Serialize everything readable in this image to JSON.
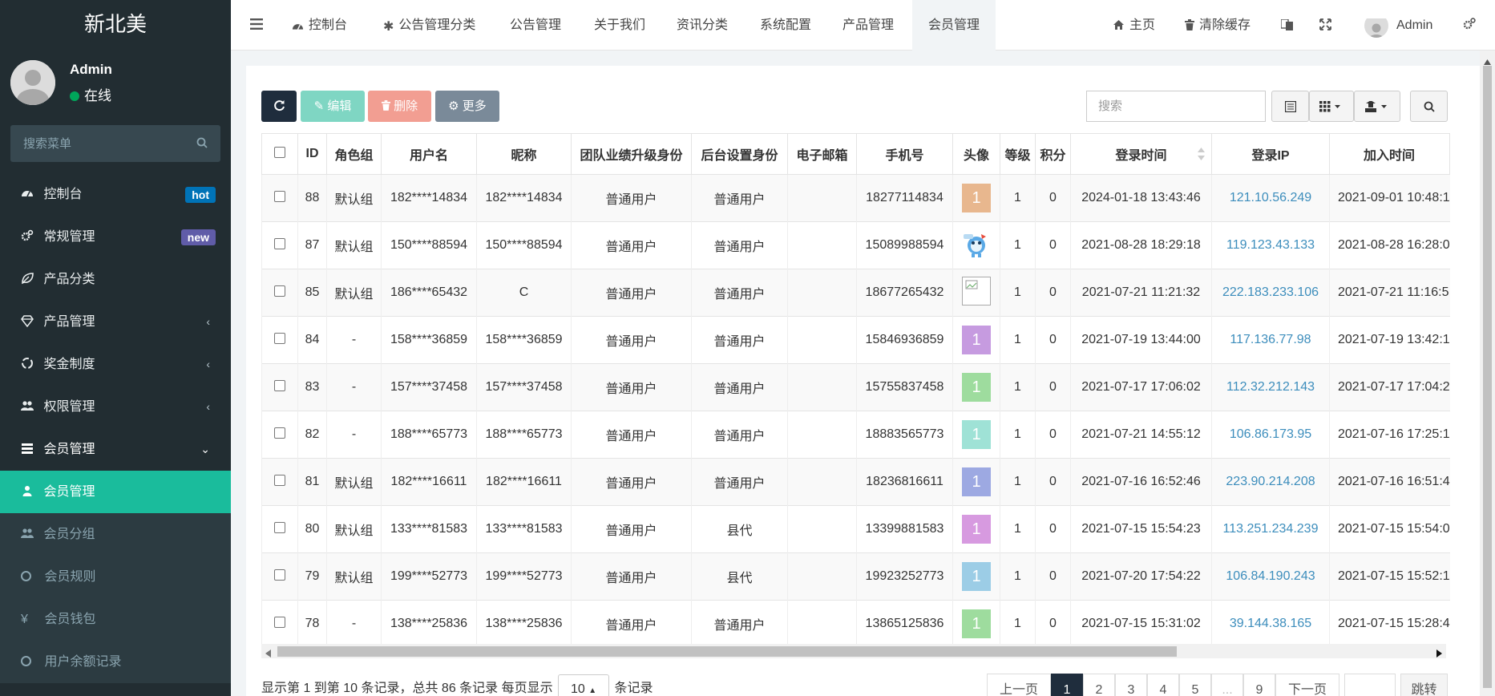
{
  "sidebar": {
    "logo": "新北美",
    "user": {
      "name": "Admin",
      "status": "在线"
    },
    "search_placeholder": "搜索菜单",
    "items": [
      {
        "label": "控制台",
        "badge": "hot",
        "badge_color": "#0073b7"
      },
      {
        "label": "常规管理",
        "badge": "new",
        "badge_color": "#605ca8"
      },
      {
        "label": "产品分类"
      },
      {
        "label": "产品管理"
      },
      {
        "label": "奖金制度"
      },
      {
        "label": "权限管理"
      },
      {
        "label": "会员管理"
      }
    ],
    "subitems": [
      {
        "label": "会员管理"
      },
      {
        "label": "会员分组"
      },
      {
        "label": "会员规则"
      },
      {
        "label": "会员钱包"
      },
      {
        "label": "用户余额记录"
      }
    ],
    "yen_symbol": "¥"
  },
  "topnav": {
    "tabs": [
      "控制台",
      "公告管理分类",
      "公告管理",
      "关于我们",
      "资讯分类",
      "系统配置",
      "产品管理",
      "会员管理"
    ],
    "home": "主页",
    "clear_cache": "清除缓存",
    "admin": "Admin"
  },
  "toolbar": {
    "edit": "编辑",
    "delete": "删除",
    "more": "更多",
    "search_placeholder": "搜索"
  },
  "table": {
    "headers": [
      "ID",
      "角色组",
      "用户名",
      "昵称",
      "团队业绩升级身份",
      "后台设置身份",
      "电子邮箱",
      "手机号",
      "头像",
      "等级",
      "积分",
      "登录时间",
      "登录IP",
      "加入时间"
    ],
    "rows": [
      {
        "id": "88",
        "group": "默认组",
        "username": "182****14834",
        "nickname": "182****14834",
        "team": "普通用户",
        "admin_role": "普通用户",
        "email": "",
        "mobile": "18277114834",
        "avatar": "1",
        "avatar_color": "#e8b78e",
        "level": "1",
        "score": "0",
        "logintime": "2024-01-18 13:43:46",
        "ip": "121.10.56.249",
        "jointime": "2021-09-01 10:48:1"
      },
      {
        "id": "87",
        "group": "默认组",
        "username": "150****88594",
        "nickname": "150****88594",
        "team": "普通用户",
        "admin_role": "普通用户",
        "email": "",
        "mobile": "15089988594",
        "avatar": "",
        "avatar_color": "",
        "level": "1",
        "score": "0",
        "logintime": "2021-08-28 18:29:18",
        "ip": "119.123.43.133",
        "jointime": "2021-08-28 16:28:0"
      },
      {
        "id": "85",
        "group": "默认组",
        "username": "186****65432",
        "nickname": "C",
        "team": "普通用户",
        "admin_role": "普通用户",
        "email": "",
        "mobile": "18677265432",
        "avatar": "",
        "avatar_color": "",
        "level": "1",
        "score": "0",
        "logintime": "2021-07-21 11:21:32",
        "ip": "222.183.233.106",
        "jointime": "2021-07-21 11:16:5"
      },
      {
        "id": "84",
        "group": "-",
        "username": "158****36859",
        "nickname": "158****36859",
        "team": "普通用户",
        "admin_role": "普通用户",
        "email": "",
        "mobile": "15846936859",
        "avatar": "1",
        "avatar_color": "#c69be0",
        "level": "1",
        "score": "0",
        "logintime": "2021-07-19 13:44:00",
        "ip": "117.136.77.98",
        "jointime": "2021-07-19 13:42:1"
      },
      {
        "id": "83",
        "group": "-",
        "username": "157****37458",
        "nickname": "157****37458",
        "team": "普通用户",
        "admin_role": "普通用户",
        "email": "",
        "mobile": "15755837458",
        "avatar": "1",
        "avatar_color": "#9edc9e",
        "level": "1",
        "score": "0",
        "logintime": "2021-07-17 17:06:02",
        "ip": "112.32.212.143",
        "jointime": "2021-07-17 17:04:2"
      },
      {
        "id": "82",
        "group": "-",
        "username": "188****65773",
        "nickname": "188****65773",
        "team": "普通用户",
        "admin_role": "普通用户",
        "email": "",
        "mobile": "18883565773",
        "avatar": "1",
        "avatar_color": "#9fe2d6",
        "level": "1",
        "score": "0",
        "logintime": "2021-07-21 14:55:12",
        "ip": "106.86.173.95",
        "jointime": "2021-07-16 17:25:1"
      },
      {
        "id": "81",
        "group": "默认组",
        "username": "182****16611",
        "nickname": "182****16611",
        "team": "普通用户",
        "admin_role": "普通用户",
        "email": "",
        "mobile": "18236816611",
        "avatar": "1",
        "avatar_color": "#9da9e2",
        "level": "1",
        "score": "0",
        "logintime": "2021-07-16 16:52:46",
        "ip": "223.90.214.208",
        "jointime": "2021-07-16 16:51:4"
      },
      {
        "id": "80",
        "group": "默认组",
        "username": "133****81583",
        "nickname": "133****81583",
        "team": "普通用户",
        "admin_role": "县代",
        "email": "",
        "mobile": "13399881583",
        "avatar": "1",
        "avatar_color": "#d79ae0",
        "level": "1",
        "score": "0",
        "logintime": "2021-07-15 15:54:23",
        "ip": "113.251.234.239",
        "jointime": "2021-07-15 15:54:0"
      },
      {
        "id": "79",
        "group": "默认组",
        "username": "199****52773",
        "nickname": "199****52773",
        "team": "普通用户",
        "admin_role": "县代",
        "email": "",
        "mobile": "19923252773",
        "avatar": "1",
        "avatar_color": "#9ccde6",
        "level": "1",
        "score": "0",
        "logintime": "2021-07-20 17:54:22",
        "ip": "106.84.190.243",
        "jointime": "2021-07-15 15:52:1"
      },
      {
        "id": "78",
        "group": "-",
        "username": "138****25836",
        "nickname": "138****25836",
        "team": "普通用户",
        "admin_role": "普通用户",
        "email": "",
        "mobile": "13865125836",
        "avatar": "1",
        "avatar_color": "#9edc9e",
        "level": "1",
        "score": "0",
        "logintime": "2021-07-15 15:31:02",
        "ip": "39.144.38.165",
        "jointime": "2021-07-15 15:28:4"
      }
    ]
  },
  "footer": {
    "info_prefix": "显示第 1 到第 10 条记录，总共 86 条记录 每页显示",
    "page_size": "10",
    "info_suffix": "条记录",
    "prev": "上一页",
    "pages": [
      "1",
      "2",
      "3",
      "4",
      "5",
      "...",
      "9"
    ],
    "next": "下一页",
    "jump": "跳转"
  }
}
